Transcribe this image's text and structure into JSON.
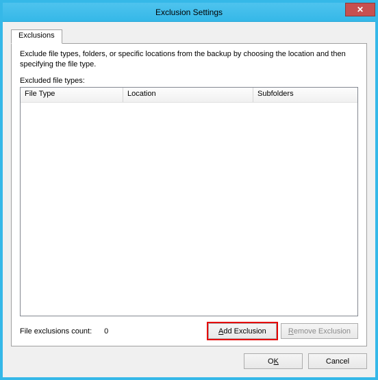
{
  "title": "Exclusion Settings",
  "tabs": {
    "exclusions": "Exclusions"
  },
  "description": "Exclude file types, folders, or specific locations from the backup by choosing the location and then specifying the file type.",
  "excluded_label": "Excluded file types:",
  "columns": {
    "file_type": "File Type",
    "location": "Location",
    "subfolders": "Subfolders"
  },
  "rows": [],
  "counter": {
    "label": "File exclusions count:",
    "value": "0"
  },
  "buttons": {
    "add_underline": "A",
    "add_rest": "dd Exclusion",
    "remove_underline": "R",
    "remove_rest": "emove Exclusion",
    "ok_pre": "O",
    "ok_underline": "K",
    "cancel": "Cancel"
  }
}
